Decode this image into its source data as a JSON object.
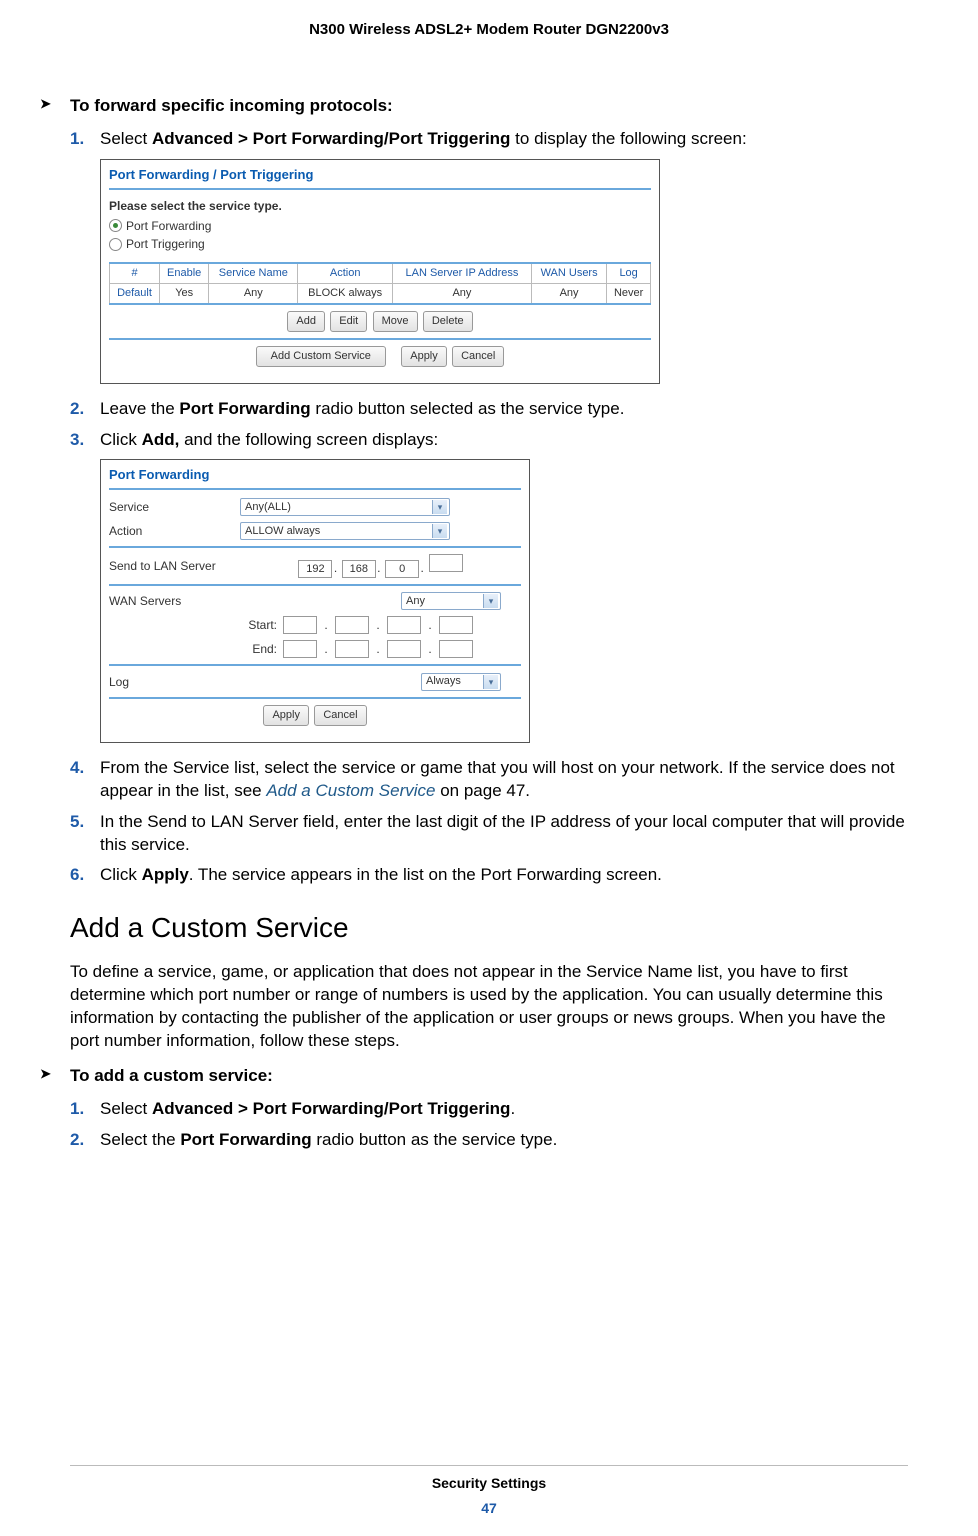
{
  "header": "N300 Wireless ADSL2+ Modem Router DGN2200v3",
  "section1": {
    "bullet": "To forward specific incoming protocols:",
    "steps": [
      {
        "n": "1.",
        "pre": "Select ",
        "b": "Advanced > Port Forwarding/Port Triggering",
        "post": " to display the following screen:"
      },
      {
        "n": "2.",
        "pre": "Leave the ",
        "b": "Port Forwarding",
        "post": " radio button selected as the service type."
      },
      {
        "n": "3.",
        "pre": "Click ",
        "b": "Add,",
        "post": " and the following screen displays:"
      },
      {
        "n": "4.",
        "text": "From the Service list, select the service or game that you will host on your network. If the service does not appear in the list, see ",
        "link": "Add a Custom Service",
        "linkpost": " on page 47."
      },
      {
        "n": "5.",
        "text": "In the Send to LAN Server field, enter the last digit of the IP address of your local computer that will provide this service."
      },
      {
        "n": "6.",
        "pre": "Click ",
        "b": "Apply",
        "post": ". The service appears in the list on the Port Forwarding screen."
      }
    ]
  },
  "shot1": {
    "title": "Port Forwarding / Port Triggering",
    "prompt": "Please select the service type.",
    "radio1": "Port Forwarding",
    "radio2": "Port Triggering",
    "cols": [
      "#",
      "Enable",
      "Service Name",
      "Action",
      "LAN Server IP Address",
      "WAN Users",
      "Log"
    ],
    "row": [
      "Default",
      "Yes",
      "Any",
      "BLOCK always",
      "Any",
      "Any",
      "Never"
    ],
    "btns1": [
      "Add",
      "Edit",
      "Move",
      "Delete"
    ],
    "btns2": [
      "Add Custom Service",
      "Apply",
      "Cancel"
    ]
  },
  "shot2": {
    "title": "Port Forwarding",
    "service_lbl": "Service",
    "service_val": "Any(ALL)",
    "action_lbl": "Action",
    "action_val": "ALLOW always",
    "send_lbl": "Send to LAN Server",
    "ip": [
      "192",
      "168",
      "0",
      ""
    ],
    "wan_lbl": "WAN Servers",
    "wan_val": "Any",
    "start": "Start:",
    "end": "End:",
    "log_lbl": "Log",
    "log_val": "Always",
    "btns": [
      "Apply",
      "Cancel"
    ]
  },
  "h2": "Add a Custom Service",
  "para": "To define a service, game, or application that does not appear in the Service Name list, you have to first determine which port number or range of numbers is used by the application. You can usually determine this information by contacting the publisher of the application or user groups or news groups. When you have the port number information, follow these steps.",
  "section2": {
    "bullet": "To add a custom service:",
    "steps": [
      {
        "n": "1.",
        "pre": "Select ",
        "b": "Advanced > Port Forwarding/Port Triggering",
        "post": "."
      },
      {
        "n": "2.",
        "pre": "Select the ",
        "b": "Port Forwarding",
        "post": " radio button as the service type."
      }
    ]
  },
  "footer": {
    "chap": "Security Settings",
    "page": "47"
  }
}
